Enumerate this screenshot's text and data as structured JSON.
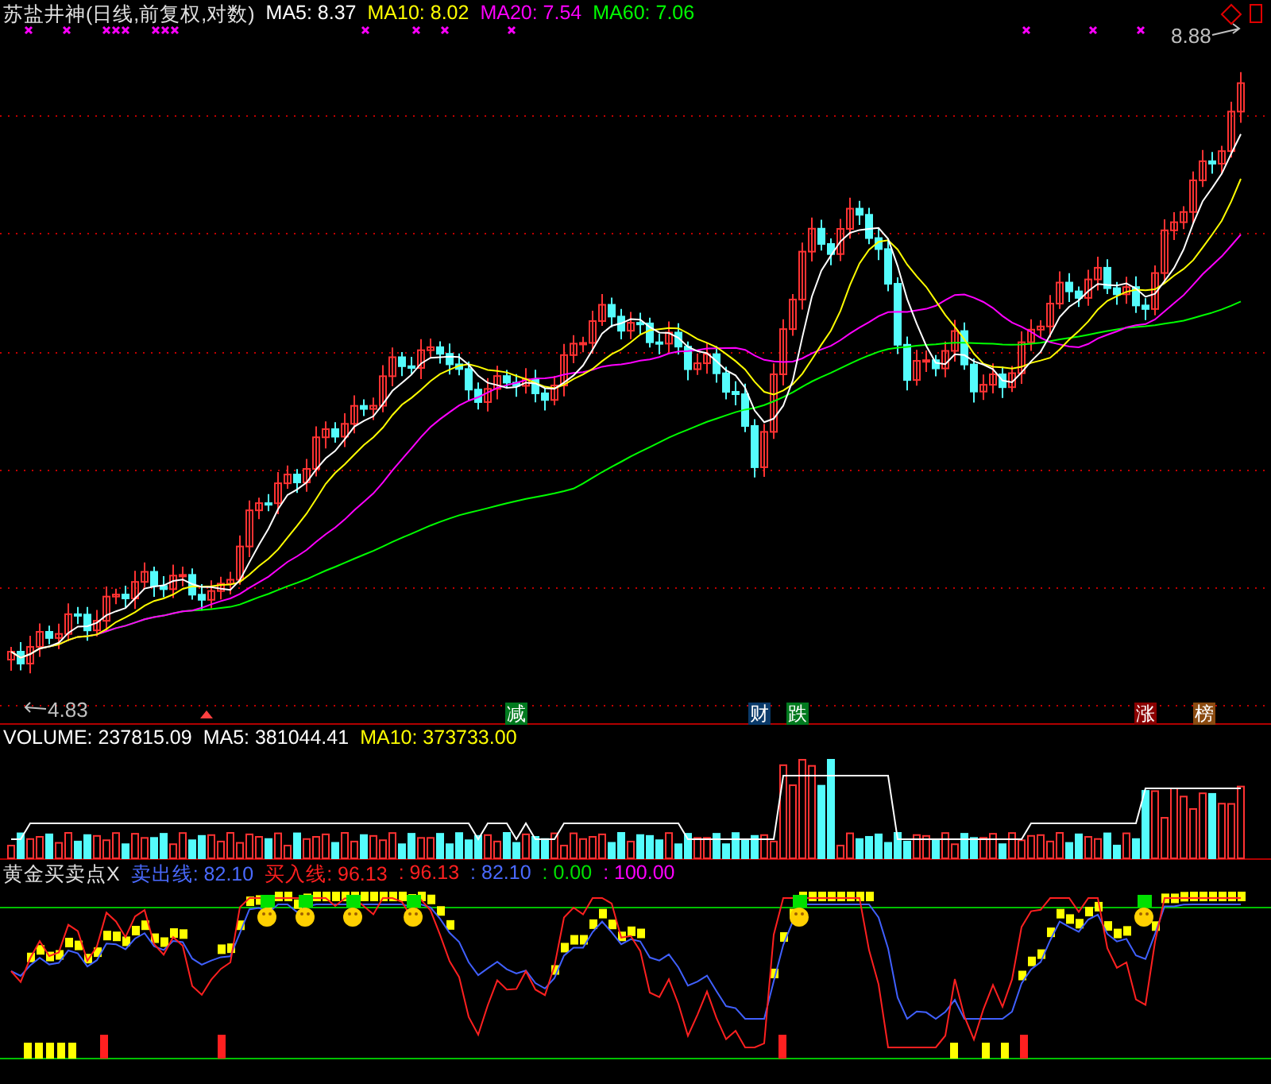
{
  "price_panel": {
    "title": "苏盐井神(日线,前复权,对数)",
    "ma_readings": [
      {
        "text": "MA5: 8.37",
        "color": "#ffffff"
      },
      {
        "text": "MA10: 8.02",
        "color": "#ffff00"
      },
      {
        "text": "MA20: 7.54",
        "color": "#ff00ff"
      },
      {
        "text": "MA60: 7.06",
        "color": "#00ff00"
      }
    ],
    "high_label": "8.88",
    "low_label": "4.83",
    "event_tags": [
      {
        "text": "减",
        "color": "#007a1e"
      },
      {
        "text": "财",
        "color": "#0a3a6a"
      },
      {
        "text": "跌",
        "color": "#007a1e"
      },
      {
        "text": "涨",
        "color": "#8a0000"
      },
      {
        "text": "榜",
        "color": "#8a4a10"
      }
    ]
  },
  "volume_panel": {
    "readings": [
      {
        "text": "VOLUME: 237815.09",
        "color": "#ffffff"
      },
      {
        "text": "MA5: 381044.41",
        "color": "#ffffff"
      },
      {
        "text": "MA10: 373733.00",
        "color": "#ffff00"
      }
    ]
  },
  "indicator_panel": {
    "title": "黄金买卖点X",
    "readings": [
      {
        "text": "卖出线: 82.10",
        "color": "#4a6aff"
      },
      {
        "text": "买入线: 96.13",
        "color": "#ff2020"
      },
      {
        "text": ": 96.13",
        "color": "#ff2020"
      },
      {
        "text": ": 82.10",
        "color": "#4a6aff"
      },
      {
        "text": ": 0.00",
        "color": "#00e000"
      },
      {
        "text": ": 100.00",
        "color": "#ff00ff"
      }
    ]
  }
}
